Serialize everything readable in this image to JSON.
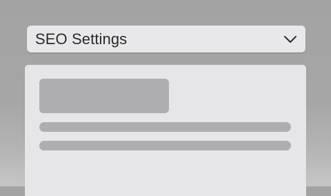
{
  "dropdown": {
    "label": "SEO Settings",
    "icon": "chevron-down-icon"
  },
  "colors": {
    "background": "#a6a6a6",
    "panel": "#e8e7e9",
    "placeholder": "#aeadaf",
    "text": "#2b2b2b"
  }
}
